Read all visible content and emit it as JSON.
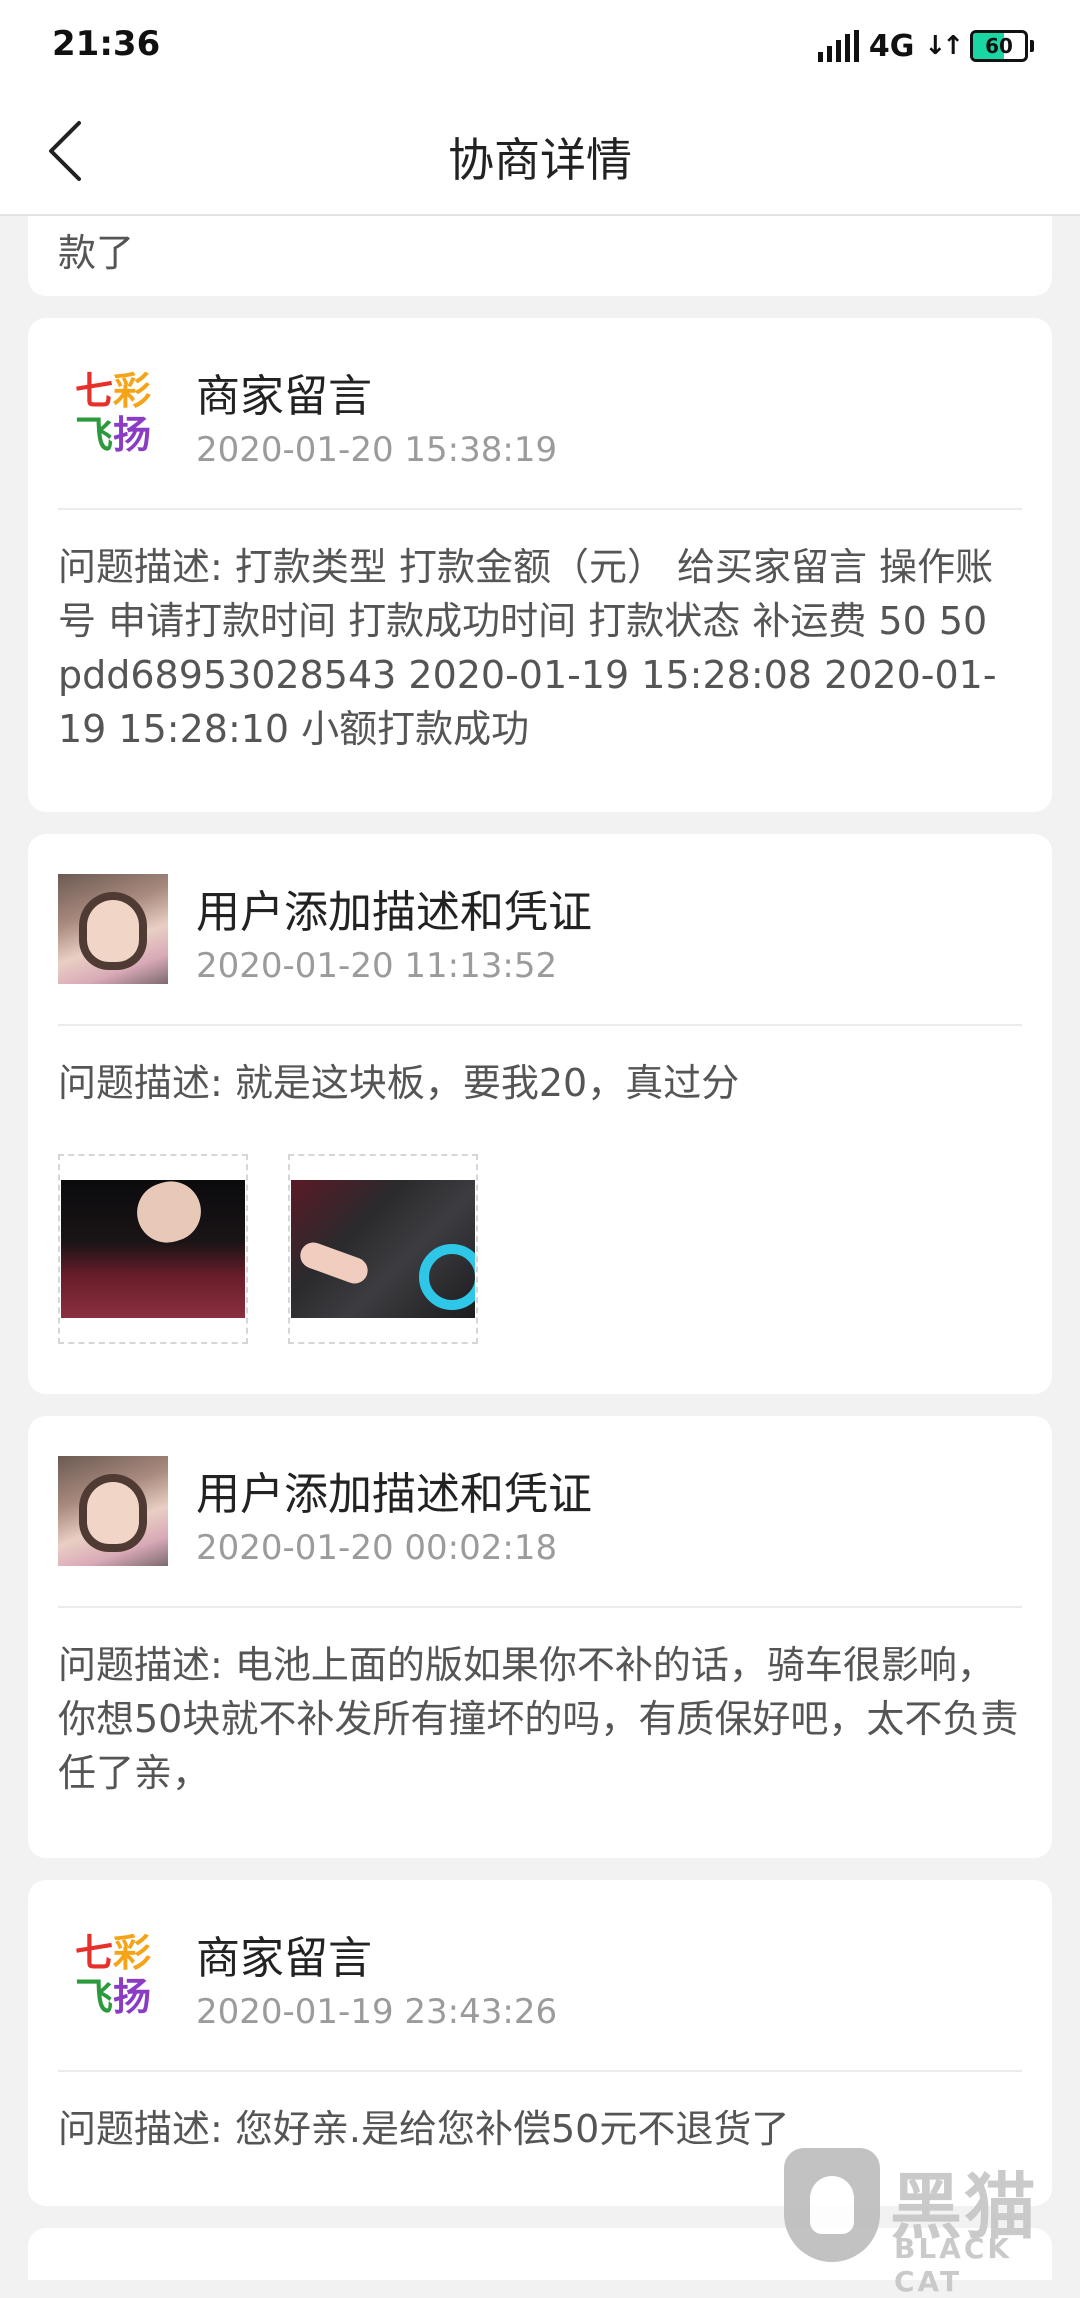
{
  "status_bar": {
    "time": "21:36",
    "network": "4G",
    "arrows": "↓↑",
    "battery": "60",
    "battery_level": 0.6
  },
  "header": {
    "title": "协商详情"
  },
  "cards": [
    {
      "partial_text": "款了"
    },
    {
      "avatar": "shop-logo",
      "logo_line1": "七彩",
      "logo_line2": "飞扬",
      "title": "商家留言",
      "time": "2020-01-20 15:38:19",
      "description": "问题描述: 打款类型 打款金额（元） 给买家留言 操作账号 申请打款时间 打款成功时间 打款状态 补运费 50 50 pdd68953028543 2020-01-19 15:28:08 2020-01-19 15:28:10 小额打款成功"
    },
    {
      "avatar": "user-photo",
      "title": "用户添加描述和凭证",
      "time": "2020-01-20 11:13:52",
      "description": "问题描述: 就是这块板，要我20，真过分",
      "images": [
        "evidence-photo-1",
        "evidence-photo-2"
      ]
    },
    {
      "avatar": "user-photo",
      "title": "用户添加描述和凭证",
      "time": "2020-01-20 00:02:18",
      "description": "问题描述: 电池上面的版如果你不补的话，骑车很影响，你想50块就不补发所有撞坏的吗，有质保好吧，太不负责任了亲，"
    },
    {
      "avatar": "shop-logo",
      "logo_line1": "七彩",
      "logo_line2": "飞扬",
      "title": "商家留言",
      "time": "2020-01-19 23:43:26",
      "description": "问题描述: 您好亲.是给您补偿50元不退货了"
    }
  ],
  "watermark": {
    "cn": "黑猫",
    "en": "BLACK CAT"
  },
  "colors": {
    "logo_chars": [
      "#e8302a",
      "#f5a418",
      "#2c9a3c",
      "#8a3cc4"
    ]
  }
}
